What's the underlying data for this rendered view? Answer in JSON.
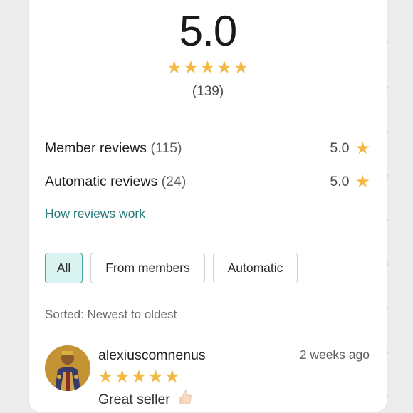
{
  "summary": {
    "score": "5.0",
    "stars": "★★★★★",
    "total": "(139)"
  },
  "breakdown": [
    {
      "label": "Member reviews",
      "count": "(115)",
      "score": "5.0"
    },
    {
      "label": "Automatic reviews",
      "count": "(24)",
      "score": "5.0"
    }
  ],
  "how_link": "How reviews work",
  "filters": {
    "all": "All",
    "members": "From members",
    "automatic": "Automatic",
    "selected": "All"
  },
  "sorted_text": "Sorted: Newest to oldest",
  "review": {
    "reviewer": "alexiuscomnenus",
    "when": "2 weeks ago",
    "stars": "★★★★★",
    "rating": 5,
    "text": "Great seller"
  },
  "colors": {
    "star": "#f4b942",
    "link": "#2a7a7a",
    "chip_active_bg": "#d9f3f1",
    "chip_active_border": "#4aa7a3"
  }
}
